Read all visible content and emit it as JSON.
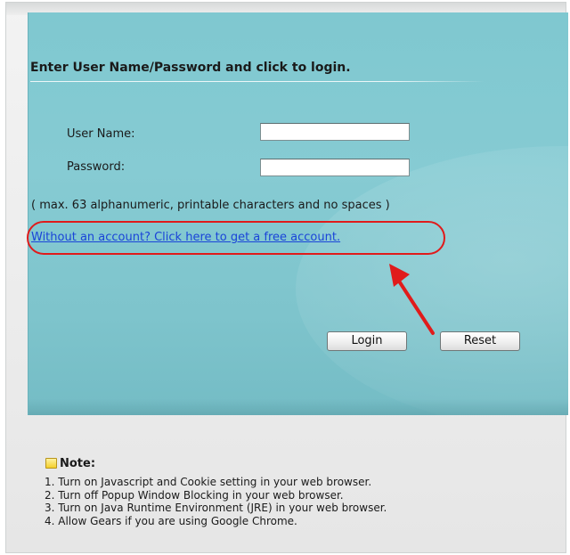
{
  "login": {
    "title": "Enter User Name/Password and click to login.",
    "username_label": "User Name:",
    "username_value": "",
    "password_label": "Password:",
    "password_value": "",
    "hint": "( max. 63 alphanumeric, printable characters and no spaces )",
    "signup_link": "Without an account? Click here to get a free account.",
    "login_button": "Login",
    "reset_button": "Reset"
  },
  "annotation": {
    "highlight_color": "#e01b1b"
  },
  "note": {
    "title": "Note:",
    "items": [
      "1. Turn on Javascript and Cookie setting in your web browser.",
      "2. Turn off Popup Window Blocking in your web browser.",
      "3. Turn on Java Runtime Environment (JRE) in your web browser.",
      "4. Allow Gears if you are using Google Chrome."
    ]
  },
  "colors": {
    "panel_bg": "#86cbd3",
    "link": "#1a44d8",
    "note_icon": "#f4cf2a"
  }
}
